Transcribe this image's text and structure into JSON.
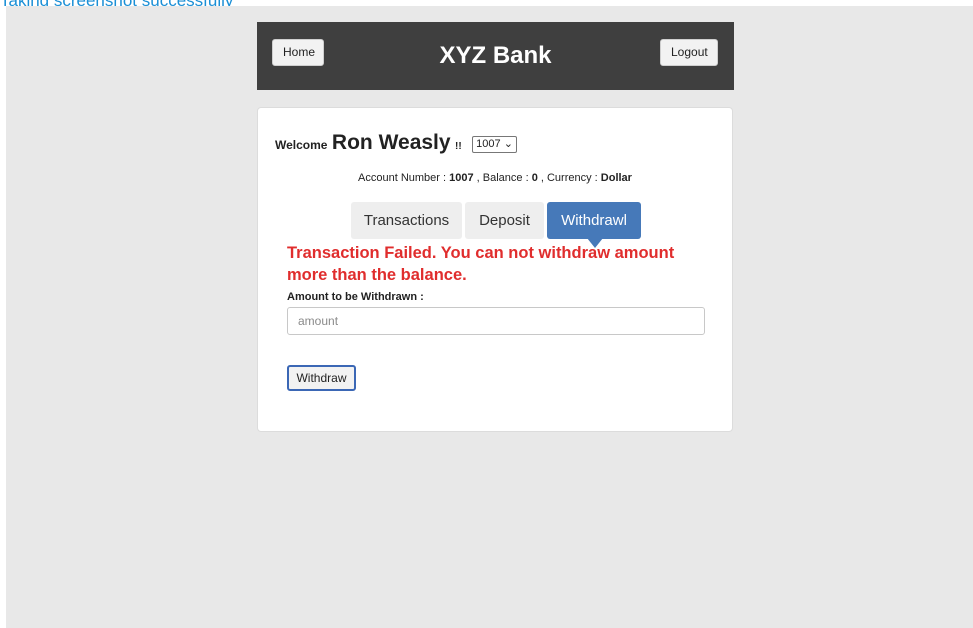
{
  "top_caption": "Taking screenshot successfully",
  "header": {
    "home_label": "Home",
    "title": "XYZ Bank",
    "logout_label": "Logout"
  },
  "welcome": {
    "prefix": "Welcome",
    "customer_name": "Ron Weasly",
    "suffix": "!!",
    "account_select_value": "1007"
  },
  "account_info": {
    "account_number_label": "Account Number : ",
    "account_number": "1007",
    "balance_label": " , Balance : ",
    "balance": "0",
    "currency_label": " , Currency : ",
    "currency": "Dollar"
  },
  "tabs": [
    {
      "label": "Transactions",
      "active": false
    },
    {
      "label": "Deposit",
      "active": false
    },
    {
      "label": "Withdrawl",
      "active": true
    }
  ],
  "withdraw_form": {
    "error_message": "Transaction Failed. You can not withdraw amount more than the balance.",
    "amount_label": "Amount to be Withdrawn :",
    "amount_placeholder": "amount",
    "amount_value": "",
    "submit_label": "Withdraw"
  },
  "colors": {
    "background": "#e8e8e8",
    "header_bg": "#3f3f3f",
    "active_tab": "#4679b9",
    "error_text": "#e02d2d",
    "caption_text": "#1a8fd6"
  }
}
